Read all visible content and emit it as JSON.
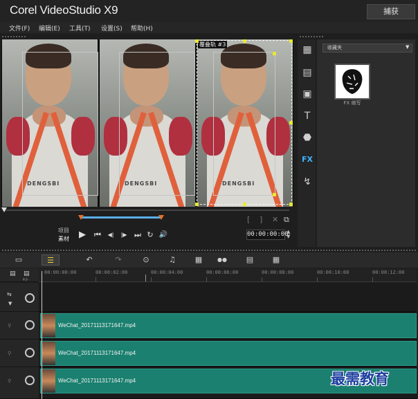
{
  "app": {
    "title": "Corel VideoStudio X9",
    "capture_label": "捕获"
  },
  "menu": [
    "文件(F)",
    "编辑(E)",
    "工具(T)",
    "设置(S)",
    "帮助(H)"
  ],
  "preview": {
    "selected_label": "覆叠轨 #3",
    "print_text": "DENGSBI"
  },
  "player": {
    "mode_project": "项目",
    "mode_clip": "素材",
    "timecode": "00:00:00:00",
    "scrub_position": 0.0,
    "trim_start": 0.27,
    "trim_end": 0.55,
    "controls": {
      "play": "▶",
      "home": "⏮",
      "prev": "◀|",
      "next": "|▶",
      "end": "⏭",
      "repeat": "↻",
      "volume": "🔊"
    },
    "mark_in": "[",
    "mark_out": "]",
    "cut": "✕",
    "enlarge": "⧉"
  },
  "library": {
    "folder": "收藏夹",
    "item_label": "FX 缩写"
  },
  "side_icons": [
    "media-icon",
    "instant-project-icon",
    "transition-icon",
    "title-icon",
    "graphics-icon",
    "filter-icon",
    "path-icon"
  ],
  "side_labels": [
    "▦",
    "▤",
    "▣",
    "T",
    "⬣",
    "FX",
    "↯"
  ],
  "timeline": {
    "tools": [
      "▭",
      "☰",
      "↶",
      "↷",
      "⊙",
      "♫",
      "▦",
      "●●",
      "▤",
      "▦"
    ],
    "ruler": [
      "00:00:00:00",
      "00:00:02:00",
      "00:00:04:00",
      "00:00:06:00",
      "00:00:08:00",
      "00:00:10:00",
      "00:00:12:00"
    ],
    "zoom_label": "+/-",
    "tracks": [
      {
        "clip": ""
      },
      {
        "clip": "WeChat_20171113171647.mp4"
      },
      {
        "clip": "WeChat_20171113171647.mp4"
      },
      {
        "clip": "WeChat_20171113171647.mp4"
      }
    ]
  },
  "watermark": "最需教育"
}
